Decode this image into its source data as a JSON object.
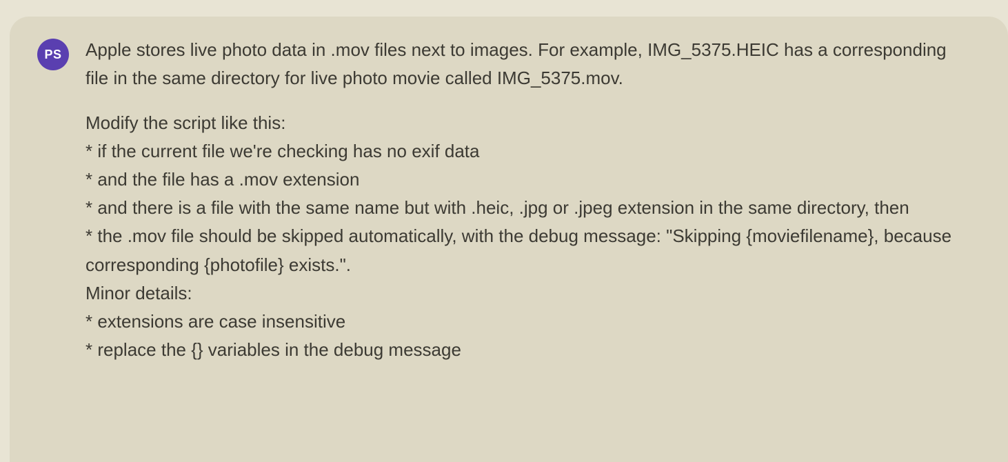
{
  "avatar": {
    "initials": "PS",
    "bg": "#5a3fb0",
    "fg": "#ffffff"
  },
  "message": {
    "p0": "Apple stores live photo data in .mov files next to images. For example, IMG_5375.HEIC has a corresponding file in the same directory for live photo movie called IMG_5375.mov.",
    "p1": "Modify the script like this:",
    "b1": "* if the current file we're checking has no exif data",
    "b2": "* and the file has a .mov extension",
    "b3": "* and there is a file with the same name but with .heic, .jpg or .jpeg extension in the same directory, then",
    "b4": "* the .mov file should be skipped automatically, with the debug message: \"Skipping {moviefilename}, because corresponding {photofile} exists.\".",
    "p2": "Minor details:",
    "b5": "* extensions are case insensitive",
    "b6": "* replace the {} variables in the debug message"
  }
}
